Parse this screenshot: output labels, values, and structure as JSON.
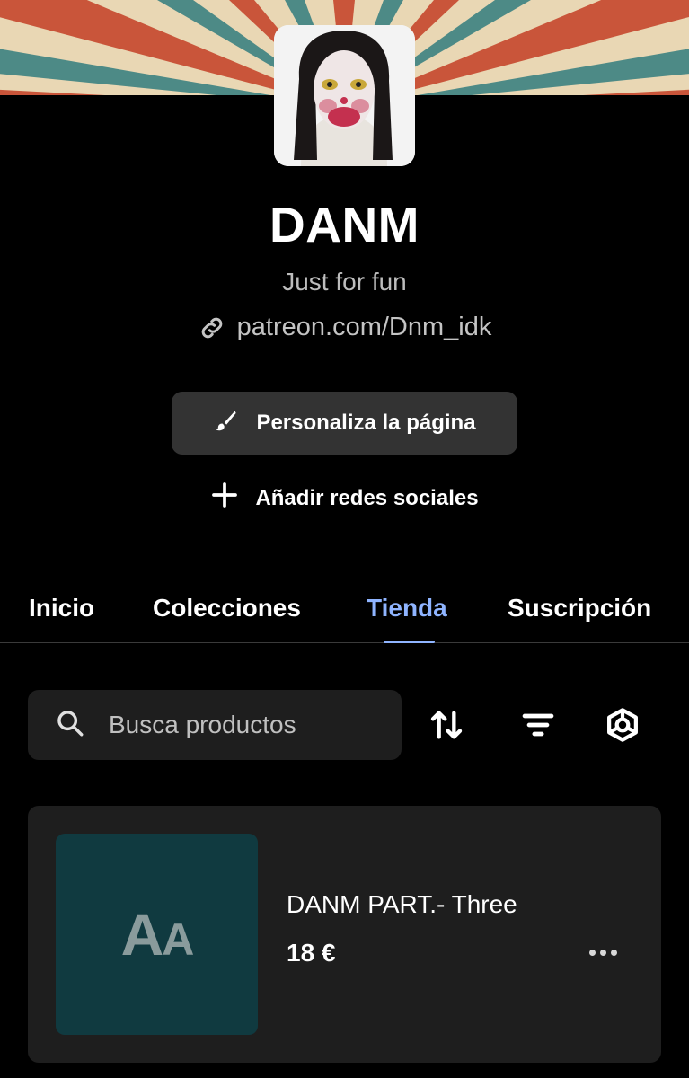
{
  "profile": {
    "name": "DANM",
    "tagline": "Just for fun",
    "link": "patreon.com/Dnm_idk"
  },
  "actions": {
    "customize_label": "Personaliza la página",
    "social_label": "Añadir redes sociales"
  },
  "tabs": [
    {
      "label": "Inicio",
      "active": false
    },
    {
      "label": "Colecciones",
      "active": false
    },
    {
      "label": "Tienda",
      "active": true
    },
    {
      "label": "Suscripción",
      "active": false
    }
  ],
  "search": {
    "placeholder": "Busca productos"
  },
  "toolbar": {
    "icons": [
      "sort-icon",
      "filter-icon",
      "settings-icon"
    ]
  },
  "products": [
    {
      "title": "DANM PART.- Three",
      "price": "18 €",
      "thumbnail_glyph": "Aa"
    }
  ],
  "colors": {
    "background": "#000000",
    "surface": "#1e1e1e",
    "button": "#333333",
    "accent": "#8fb4ff",
    "thumbnail": "#103a40"
  }
}
